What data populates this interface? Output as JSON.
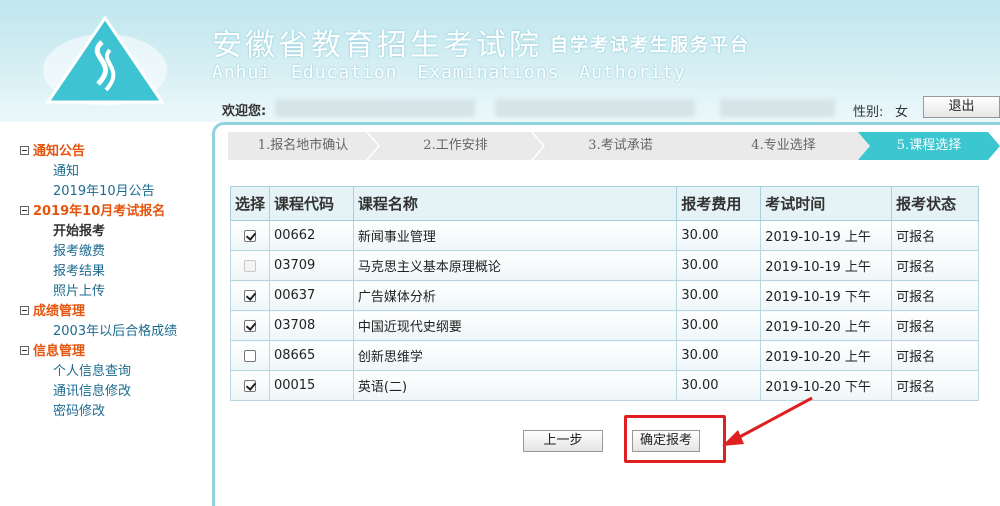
{
  "header": {
    "title_cn": "安徽省教育招生考试院",
    "subtitle_cn": "自学考试考生服务平台",
    "title_en": "Anhui Education Examinations Authority",
    "welcome_label": "欢迎您:",
    "gender_label": "性别:",
    "gender_value": "女",
    "logout_label": "退出"
  },
  "sidebar": {
    "groups": [
      {
        "label": "通知公告",
        "items": [
          "通知",
          "2019年10月公告"
        ]
      },
      {
        "label": "2019年10月考试报名",
        "items": [
          "开始报考",
          "报考缴费",
          "报考结果",
          "照片上传"
        ]
      },
      {
        "label": "成绩管理",
        "items": [
          "2003年以后合格成绩"
        ]
      },
      {
        "label": "信息管理",
        "items": [
          "个人信息查询",
          "通讯信息修改",
          "密码修改"
        ]
      }
    ],
    "active_item": "开始报考"
  },
  "steps": [
    "1.报名地市确认",
    "2.工作安排",
    "3.考试承诺",
    "4.专业选择",
    "5.课程选择"
  ],
  "current_step": 5,
  "table": {
    "headers": [
      "选择",
      "课程代码",
      "课程名称",
      "报考费用",
      "考试时间",
      "报考状态"
    ],
    "rows": [
      {
        "checked": true,
        "disabled": false,
        "code": "00662",
        "name": "新闻事业管理",
        "fee": "30.00",
        "time": "2019-10-19 上午",
        "status": "可报名"
      },
      {
        "checked": false,
        "disabled": true,
        "code": "03709",
        "name": "马克思主义基本原理概论",
        "fee": "30.00",
        "time": "2019-10-19 上午",
        "status": "可报名"
      },
      {
        "checked": true,
        "disabled": false,
        "code": "00637",
        "name": "广告媒体分析",
        "fee": "30.00",
        "time": "2019-10-19 下午",
        "status": "可报名"
      },
      {
        "checked": true,
        "disabled": false,
        "code": "03708",
        "name": "中国近现代史纲要",
        "fee": "30.00",
        "time": "2019-10-20 上午",
        "status": "可报名"
      },
      {
        "checked": false,
        "disabled": false,
        "code": "08665",
        "name": "创新思维学",
        "fee": "30.00",
        "time": "2019-10-20 上午",
        "status": "可报名"
      },
      {
        "checked": true,
        "disabled": false,
        "code": "00015",
        "name": "英语(二)",
        "fee": "30.00",
        "time": "2019-10-20 下午",
        "status": "可报名"
      }
    ]
  },
  "buttons": {
    "prev": "上一步",
    "confirm": "确定报考"
  },
  "colors": {
    "accent": "#3cc6cf",
    "highlight": "#e02020",
    "nav_group": "#e6550d",
    "nav_link": "#1c6b8f"
  }
}
